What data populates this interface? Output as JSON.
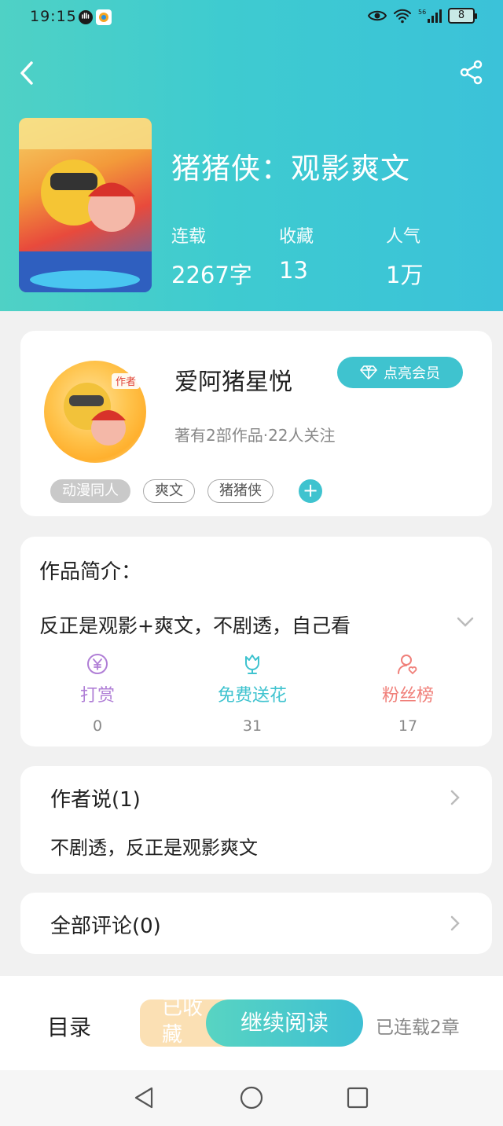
{
  "status_bar": {
    "time": "19:15",
    "battery": "8",
    "signal": "56"
  },
  "book": {
    "title": "猪猪侠：观影爽文",
    "stats": [
      {
        "label": "连载",
        "value": "2267字"
      },
      {
        "label": "收藏",
        "value": "13"
      },
      {
        "label": "人气",
        "value": "1万"
      }
    ]
  },
  "author": {
    "name": "爱阿猪星悦",
    "vip_label": "点亮会员",
    "meta": "著有2部作品·22人关注",
    "avatar_badge": "作者",
    "tags": [
      "动漫同人",
      "爽文",
      "猪猪侠"
    ]
  },
  "intro": {
    "heading": "作品简介：",
    "text": "反正是观影+爽文，不剧透，自己看",
    "actions": [
      {
        "label": "打赏",
        "count": "0",
        "color": "#b07fd6"
      },
      {
        "label": "免费送花",
        "count": "31",
        "color": "#3fc3cf"
      },
      {
        "label": "粉丝榜",
        "count": "17",
        "color": "#f0807a"
      }
    ]
  },
  "author_say": {
    "heading": "作者说(1)",
    "text": "不剧透，反正是观影爽文"
  },
  "comments": {
    "heading": "全部评论(0)"
  },
  "bottom_bar": {
    "toc": "目录",
    "favorited": "已收藏",
    "continue": "继续阅读",
    "serial": "已连载2章"
  },
  "colors": {
    "accent": "#3fc3cf",
    "header_start": "#4fd1c5",
    "header_end": "#3bc2d9"
  }
}
